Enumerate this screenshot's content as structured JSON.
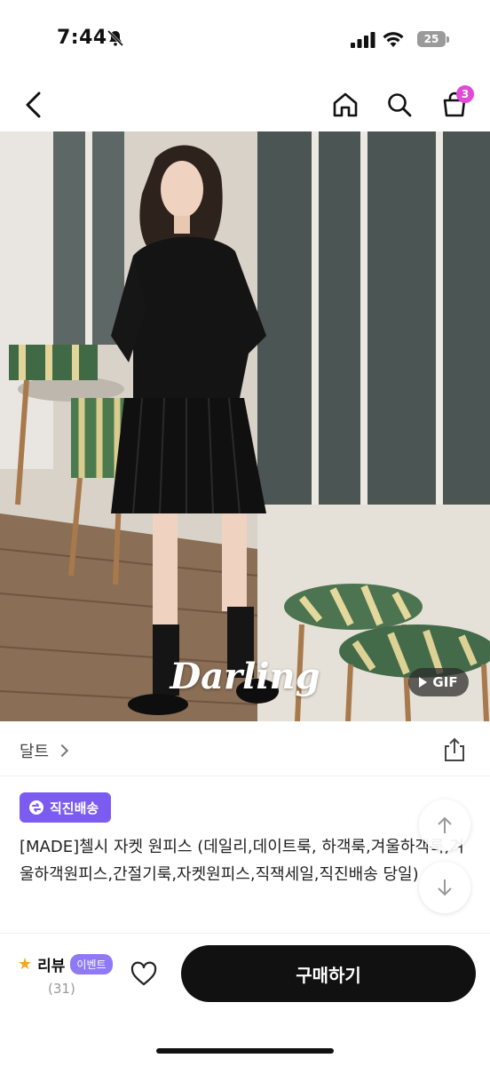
{
  "status_bar": {
    "time": "7:44",
    "battery": "25",
    "icons": [
      "bell-off-icon",
      "signal-icon",
      "wifi-icon",
      "battery-icon"
    ]
  },
  "nav": {
    "icons": [
      "back-arrow-icon",
      "home-icon",
      "search-icon",
      "cart-icon"
    ],
    "cart_badge": "3"
  },
  "product_image": {
    "watermark": "Darling",
    "gif_label": "GIF"
  },
  "brand": {
    "name": "달트",
    "share_icon": "share-icon"
  },
  "shipping_badge": {
    "label": "직진배송",
    "icon": "direct-shipping-icon"
  },
  "product": {
    "title": "[MADE]첼시 자켓 원피스 (데일리,데이트룩, 하객룩,겨울하객룩,겨울하객원피스,간절기룩,자켓원피스,직잭세일,직진배송 당일)"
  },
  "scroll_buttons": [
    "arrow-up-icon",
    "arrow-down-icon"
  ],
  "bottom_bar": {
    "review_label": "리뷰",
    "event_label": "이벤트",
    "review_count": "(31)",
    "buy_label": "구매하기"
  },
  "colors": {
    "accent": "#7c5cf0",
    "cart_badge": "#e14ad5",
    "buy_button": "#111111",
    "star": "#f5a623"
  }
}
